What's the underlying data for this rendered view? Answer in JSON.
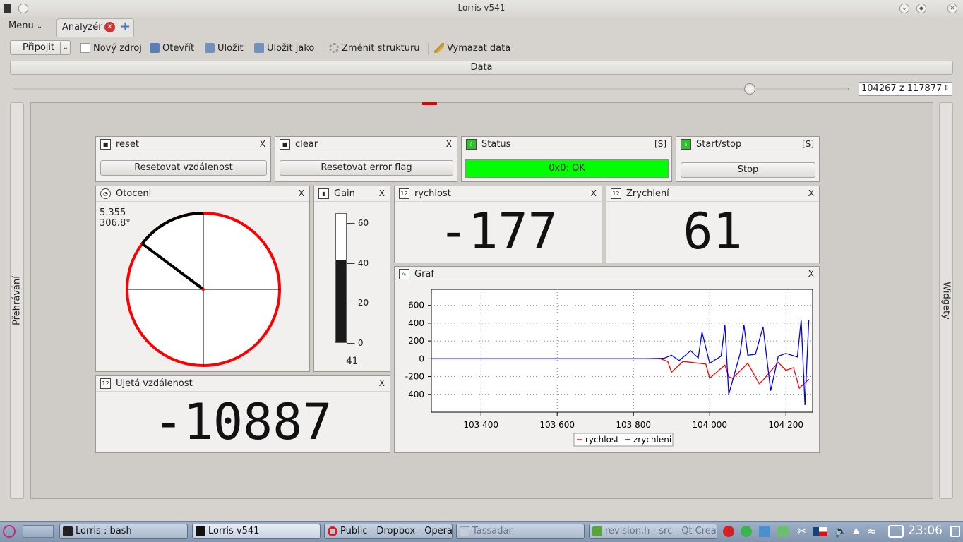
{
  "window": {
    "title": "Lorris v541"
  },
  "menu": {
    "label": "Menu"
  },
  "tabs": [
    {
      "label": "Analyzér"
    }
  ],
  "toolbar": {
    "connect_label": "Připojit",
    "new_source": "Nový zdroj",
    "open": "Otevřít",
    "save": "Uložit",
    "save_as": "Uložit jako",
    "change_structure": "Změnit strukturu",
    "clear_data": "Vymazat data"
  },
  "data_header": "Data",
  "slider": {
    "current": 104267,
    "total": 117877,
    "spin_text": "104267 z 117877"
  },
  "side_tabs": {
    "left": "Přehrávání",
    "right": "Widgety"
  },
  "widgets": {
    "reset": {
      "title": "reset",
      "close": "X",
      "button": "Resetovat vzdálenost"
    },
    "clear": {
      "title": "clear",
      "close": "X",
      "button": "Resetovat error flag"
    },
    "status": {
      "title": "Status",
      "mode": "[S]",
      "value": "0x0: OK",
      "color": "#00ff00"
    },
    "startstop": {
      "title": "Start/stop",
      "mode": "[S]",
      "button": "Stop"
    },
    "otoceni": {
      "title": "Otoceni",
      "close": "X",
      "value_line1": "5.355",
      "value_line2": "306.8°",
      "angle_deg": 306.8
    },
    "gain": {
      "title": "Gain",
      "close": "X",
      "value": "41",
      "value_num": 41,
      "min": 0,
      "max": 65,
      "ticks": [
        "60",
        "40",
        "20",
        "0"
      ]
    },
    "rychlost": {
      "title": "rychlost",
      "close": "X",
      "value": "-177"
    },
    "zrychleni": {
      "title": "Zrychlení",
      "close": "X",
      "value": "61"
    },
    "vzdalenost": {
      "title": "Ujetá vzdálenost",
      "close": "X",
      "value": "-10887"
    },
    "graf": {
      "title": "Graf",
      "close": "X"
    }
  },
  "chart_data": {
    "type": "line",
    "title": "",
    "xlabel": "",
    "ylabel": "",
    "xlim": [
      103270,
      104270
    ],
    "ylim": [
      -600,
      780
    ],
    "x_ticks": [
      "103 400",
      "103 600",
      "103 800",
      "104 000",
      "104 200"
    ],
    "y_ticks": [
      "600",
      "400",
      "200",
      "0",
      "-200",
      "-400"
    ],
    "grid": true,
    "legend_position": "bottom",
    "series": [
      {
        "name": "rychlost",
        "color": "#ff0000",
        "x": [
          103270,
          103870,
          103890,
          103900,
          103930,
          103990,
          104000,
          104040,
          104050,
          104060,
          104100,
          104130,
          104140,
          104180,
          104200,
          104220,
          104235,
          104260
        ],
        "y": [
          0,
          0,
          -30,
          -150,
          -30,
          -60,
          -220,
          -70,
          -200,
          -220,
          -50,
          -280,
          -240,
          -40,
          -130,
          -100,
          -330,
          -230
        ]
      },
      {
        "name": "zrychleni",
        "color": "#0000ff",
        "x": [
          103270,
          103830,
          103880,
          103900,
          103920,
          103950,
          103970,
          103980,
          104000,
          104030,
          104040,
          104050,
          104080,
          104090,
          104100,
          104120,
          104140,
          104160,
          104180,
          104200,
          104230,
          104240,
          104250,
          104260
        ],
        "y": [
          0,
          0,
          5,
          40,
          -20,
          90,
          10,
          300,
          -50,
          30,
          380,
          -400,
          60,
          380,
          40,
          50,
          360,
          -360,
          30,
          60,
          20,
          440,
          -520,
          430
        ]
      }
    ]
  },
  "taskbar": {
    "tasks": [
      "Lorris : bash",
      "Lorris v541",
      "Public - Dropbox - Opera",
      "Tassadar",
      "revision.h - src - Qt Crea"
    ],
    "clock": "23:06"
  }
}
